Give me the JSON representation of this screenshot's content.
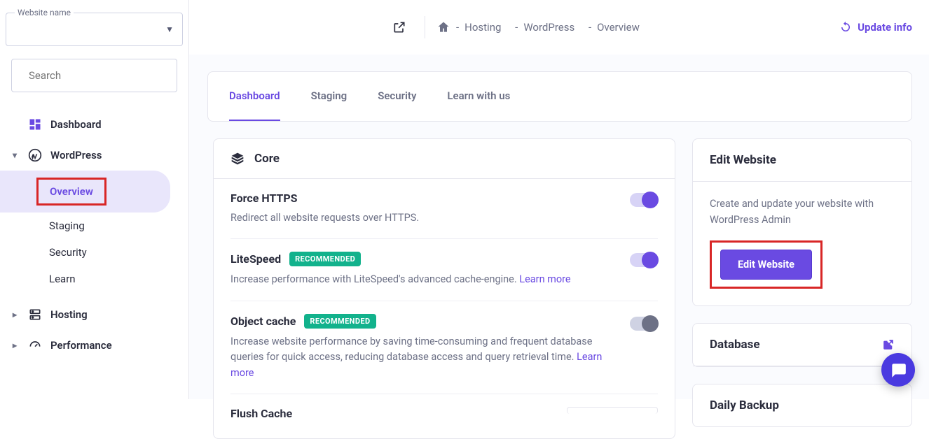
{
  "sidebar": {
    "website_name_label": "Website name",
    "search_placeholder": "Search",
    "items": {
      "dashboard": "Dashboard",
      "wordpress": "WordPress",
      "wp_children": {
        "overview": "Overview",
        "staging": "Staging",
        "security": "Security",
        "learn": "Learn"
      },
      "hosting": "Hosting",
      "performance": "Performance"
    }
  },
  "topbar": {
    "crumb_hosting": "Hosting",
    "crumb_wordpress": "WordPress",
    "crumb_overview": "Overview",
    "sep": "-",
    "update_info": "Update info"
  },
  "tabs": {
    "dashboard": "Dashboard",
    "staging": "Staging",
    "security": "Security",
    "learn": "Learn with us"
  },
  "core": {
    "title": "Core",
    "rows": {
      "https": {
        "title": "Force HTTPS",
        "desc": "Redirect all website requests over HTTPS."
      },
      "litespeed": {
        "title": "LiteSpeed",
        "badge": "RECOMMENDED",
        "desc": "Increase performance with LiteSpeed's advanced cache-engine. ",
        "learn": "Learn more"
      },
      "objcache": {
        "title": "Object cache",
        "badge": "RECOMMENDED",
        "desc": "Increase website performance by saving time-consuming and frequent database queries for quick access, reducing database access and query retrieval time. ",
        "learn": "Learn more"
      },
      "flush": {
        "title": "Flush Cache"
      }
    }
  },
  "side": {
    "edit_title": "Edit Website",
    "edit_desc": "Create and update your website with WordPress Admin",
    "edit_btn": "Edit Website",
    "database_title": "Database",
    "backup_title": "Daily Backup"
  }
}
